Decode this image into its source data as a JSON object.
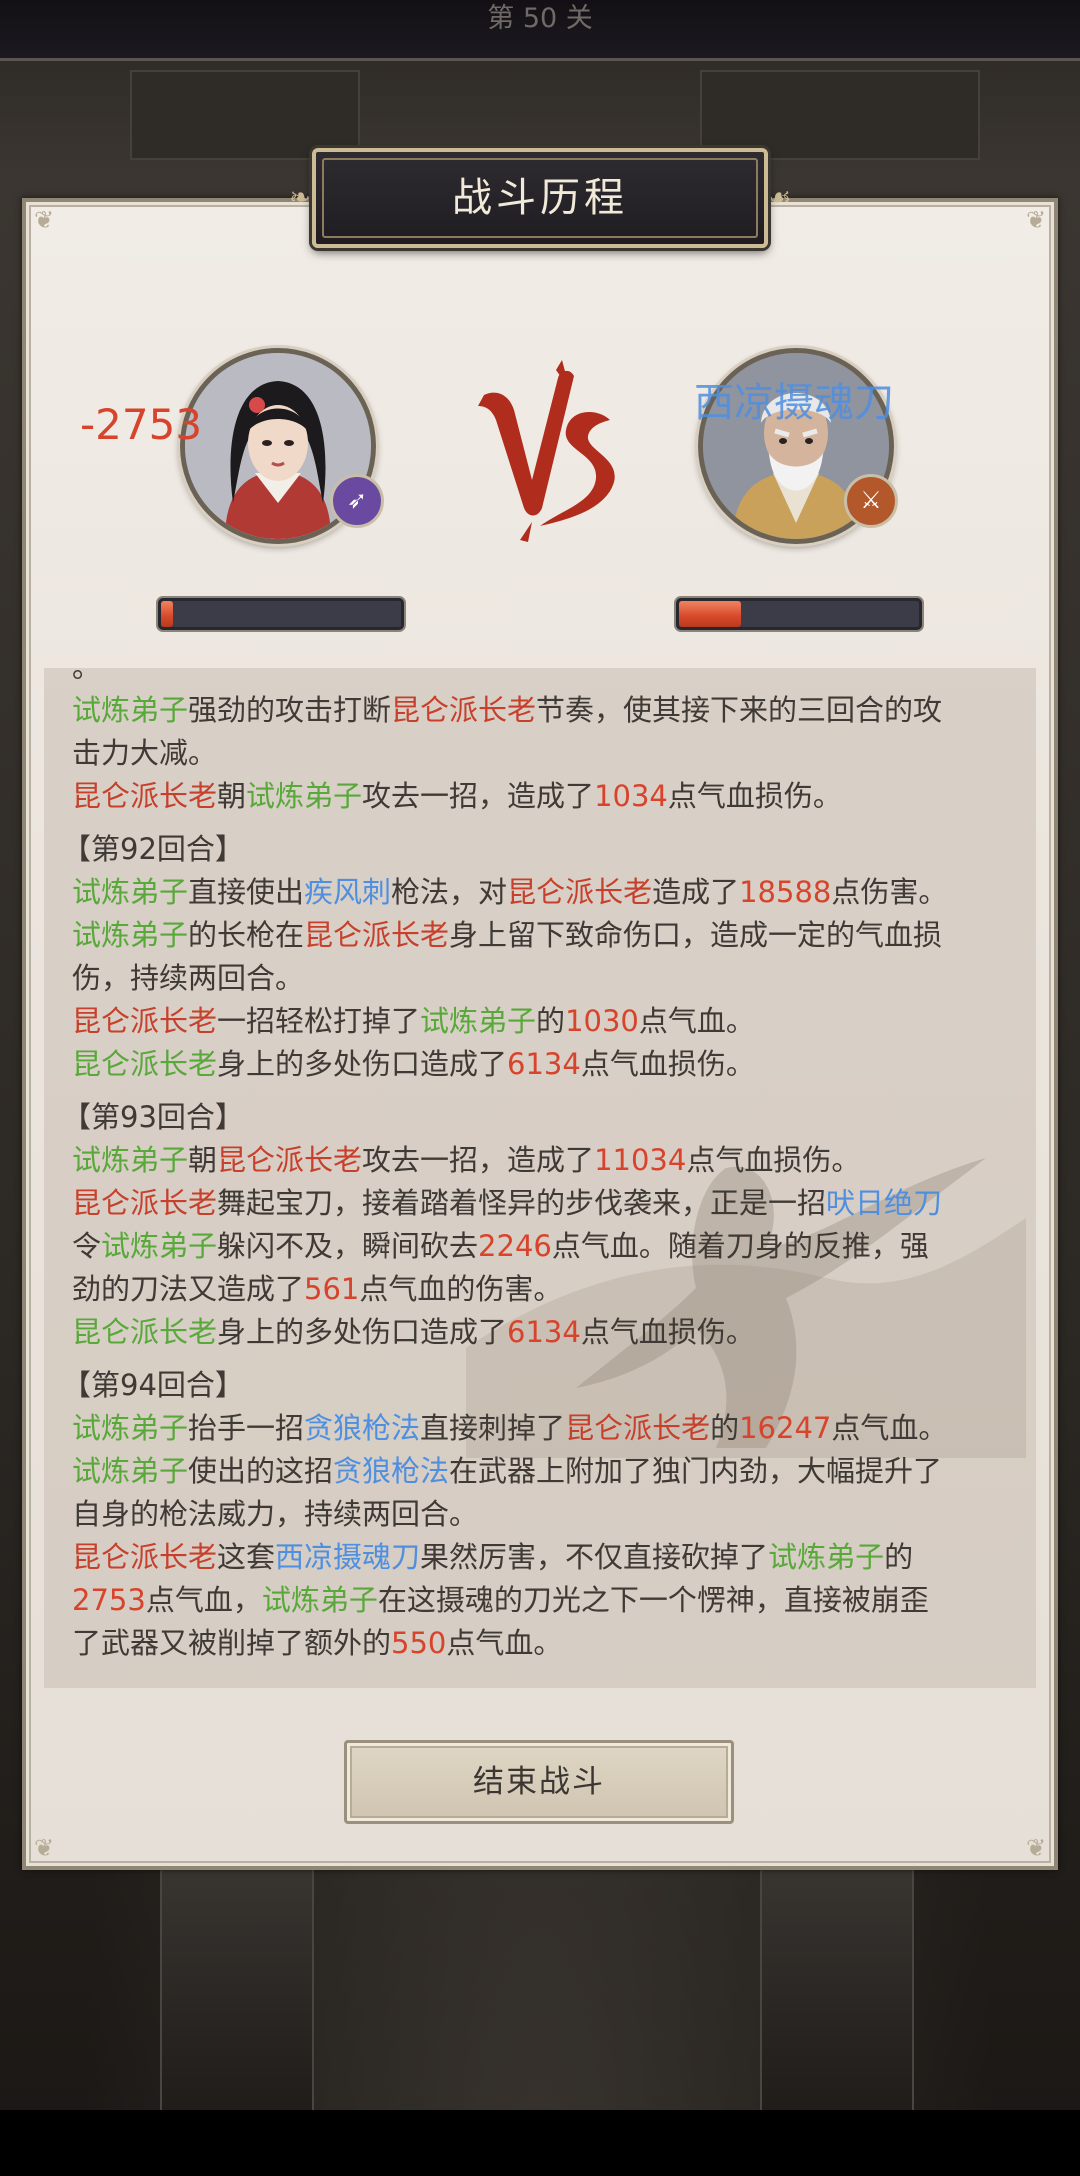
{
  "header": {
    "level": "第 50 关"
  },
  "panel": {
    "title": "战斗历程"
  },
  "battle": {
    "player": {
      "hp_fraction": 0.05,
      "damage_popup": "-2753",
      "badge_icon": "spear-icon"
    },
    "enemy": {
      "hp_fraction": 0.26,
      "skill_popup": "西凉摄魂刀",
      "badge_icon": "blade-icon"
    }
  },
  "colors": {
    "player_name": "#58a83a",
    "enemy_name": "#c6402b",
    "skill": "#4f8fe0",
    "damage_number": "#d8432b",
    "hp_fill": "#d6492a"
  },
  "log": {
    "lines": [
      [
        {
          "t": "。"
        }
      ],
      [
        {
          "t": "试炼弟子",
          "c": "g"
        },
        {
          "t": "强劲的攻击打断"
        },
        {
          "t": "昆仑派长老",
          "c": "r"
        },
        {
          "t": "节奏，使其接下来的三回合的攻"
        }
      ],
      [
        {
          "t": "击力大减。"
        }
      ],
      [
        {
          "t": "昆仑派长老",
          "c": "r"
        },
        {
          "t": "朝"
        },
        {
          "t": "试炼弟子",
          "c": "g"
        },
        {
          "t": "攻去一招，造成了"
        },
        {
          "t": "1034",
          "c": "n"
        },
        {
          "t": "点气血损伤。"
        }
      ],
      {
        "round": "【第92回合】"
      },
      [
        {
          "t": "试炼弟子",
          "c": "g"
        },
        {
          "t": "直接使出"
        },
        {
          "t": "疾风刺",
          "c": "b"
        },
        {
          "t": "枪法，对"
        },
        {
          "t": "昆仑派长老",
          "c": "r"
        },
        {
          "t": "造成了"
        },
        {
          "t": "18588",
          "c": "n"
        },
        {
          "t": "点伤害。"
        }
      ],
      [
        {
          "t": "试炼弟子",
          "c": "g"
        },
        {
          "t": "的长枪在"
        },
        {
          "t": "昆仑派长老",
          "c": "r"
        },
        {
          "t": "身上留下致命伤口，造成一定的气血损"
        }
      ],
      [
        {
          "t": "伤，持续两回合。"
        }
      ],
      [
        {
          "t": "昆仑派长老",
          "c": "r"
        },
        {
          "t": "一招轻松打掉了"
        },
        {
          "t": "试炼弟子",
          "c": "g"
        },
        {
          "t": "的"
        },
        {
          "t": "1030",
          "c": "n"
        },
        {
          "t": "点气血。"
        }
      ],
      [
        {
          "t": "昆仑派长老",
          "c": "g"
        },
        {
          "t": "身上的多处伤口造成了"
        },
        {
          "t": "6134",
          "c": "n"
        },
        {
          "t": "点气血损伤。"
        }
      ],
      {
        "round": "【第93回合】"
      },
      [
        {
          "t": "试炼弟子",
          "c": "g"
        },
        {
          "t": "朝"
        },
        {
          "t": "昆仑派长老",
          "c": "r"
        },
        {
          "t": "攻去一招，造成了"
        },
        {
          "t": "11034",
          "c": "n"
        },
        {
          "t": "点气血损伤。"
        }
      ],
      [
        {
          "t": "昆仑派长老",
          "c": "r"
        },
        {
          "t": "舞起宝刀，接着踏着怪异的步伐袭来，正是一招"
        },
        {
          "t": "吠日绝刀",
          "c": "b"
        }
      ],
      [
        {
          "t": "令"
        },
        {
          "t": "试炼弟子",
          "c": "g"
        },
        {
          "t": "躲闪不及，瞬间砍去"
        },
        {
          "t": "2246",
          "c": "n"
        },
        {
          "t": "点气血。随着刀身的反推，强"
        }
      ],
      [
        {
          "t": "劲的刀法又造成了"
        },
        {
          "t": "561",
          "c": "n"
        },
        {
          "t": "点气血的伤害。"
        }
      ],
      [
        {
          "t": "昆仑派长老",
          "c": "g"
        },
        {
          "t": "身上的多处伤口造成了"
        },
        {
          "t": "6134",
          "c": "n"
        },
        {
          "t": "点气血损伤。"
        }
      ],
      {
        "round": "【第94回合】"
      },
      [
        {
          "t": "试炼弟子",
          "c": "g"
        },
        {
          "t": "抬手一招"
        },
        {
          "t": "贪狼枪法",
          "c": "b"
        },
        {
          "t": "直接刺掉了"
        },
        {
          "t": "昆仑派长老",
          "c": "r"
        },
        {
          "t": "的"
        },
        {
          "t": "16247",
          "c": "n"
        },
        {
          "t": "点气血。"
        }
      ],
      [
        {
          "t": "试炼弟子",
          "c": "g"
        },
        {
          "t": "使出的这招"
        },
        {
          "t": "贪狼枪法",
          "c": "b"
        },
        {
          "t": "在武器上附加了独门内劲，大幅提升了"
        }
      ],
      [
        {
          "t": "自身的枪法威力，持续两回合。"
        }
      ],
      [
        {
          "t": "昆仑派长老",
          "c": "r"
        },
        {
          "t": "这套"
        },
        {
          "t": "西凉摄魂刀",
          "c": "b"
        },
        {
          "t": "果然厉害，不仅直接砍掉了"
        },
        {
          "t": "试炼弟子",
          "c": "g"
        },
        {
          "t": "的"
        }
      ],
      [
        {
          "t": "2753",
          "c": "n"
        },
        {
          "t": "点气血，"
        },
        {
          "t": "试炼弟子",
          "c": "g"
        },
        {
          "t": "在这摄魂的刀光之下一个愣神，直接被崩歪"
        }
      ],
      [
        {
          "t": "了武器又被削掉了额外的"
        },
        {
          "t": "550",
          "c": "n"
        },
        {
          "t": "点气血。"
        }
      ]
    ]
  },
  "buttons": {
    "end_battle": "结束战斗"
  }
}
